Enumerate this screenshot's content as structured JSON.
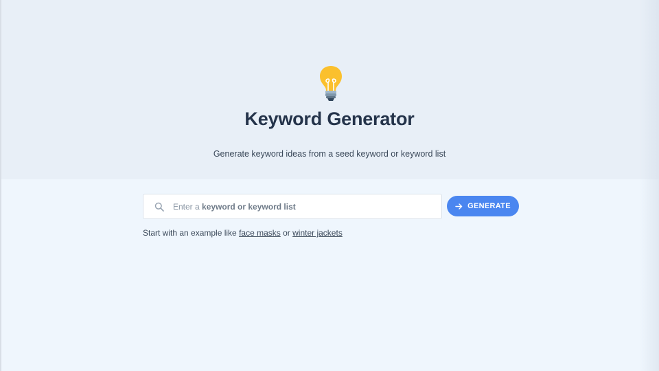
{
  "hero": {
    "title": "Keyword Generator",
    "subtitle": "Generate keyword ideas from a seed keyword or keyword list",
    "icon": "lightbulb-icon"
  },
  "search": {
    "placeholder_prefix": "Enter a ",
    "placeholder_bold": "keyword or keyword list",
    "icon": "search-icon"
  },
  "generate_button": {
    "label": "GENERATE",
    "icon": "arrow-right-icon",
    "color": "#4a86f0"
  },
  "examples": {
    "prefix": "Start with an example like",
    "link1": "face masks",
    "joiner": "or",
    "link2": "winter jackets"
  },
  "colors": {
    "hero_bg": "#e8eff7",
    "page_bg": "#eff6fd",
    "bulb": "#fbc02d"
  }
}
